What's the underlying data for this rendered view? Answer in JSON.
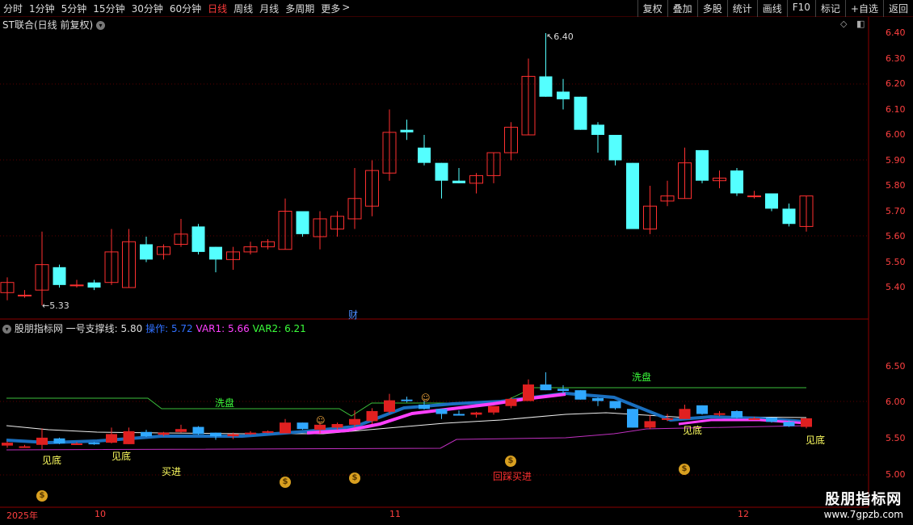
{
  "toolbar": {
    "periods": [
      "分时",
      "1分钟",
      "5分钟",
      "15分钟",
      "30分钟",
      "60分钟",
      "日线",
      "周线",
      "月线",
      "多周期",
      "更多"
    ],
    "active_period": "日线",
    "actions": [
      "复权",
      "叠加",
      "多股",
      "统计",
      "画线",
      "F10",
      "标记",
      "+自选",
      "返回"
    ]
  },
  "main_panel": {
    "title": "ST联合(日线 前复权)",
    "y_labels": [
      "6.40",
      "6.30",
      "6.20",
      "6.10",
      "6.00",
      "5.90",
      "5.80",
      "5.70",
      "5.60",
      "5.50",
      "5.40"
    ],
    "high_label": "6.40",
    "low_label": "5.33",
    "marker": "财"
  },
  "indicator_panel": {
    "name": "股朋指标网",
    "line1_label": "一号支撑线:",
    "line1_value": "5.80",
    "op_label": "操作:",
    "op_value": "5.72",
    "var1_label": "VAR1:",
    "var1_value": "5.66",
    "var2_label": "VAR2:",
    "var2_value": "6.21",
    "y_labels": [
      "6.50",
      "6.00",
      "5.50",
      "5.00"
    ],
    "annotations": {
      "wash1": "洗盘",
      "wash2": "洗盘",
      "bottom1": "见底",
      "bottom2": "见底",
      "bottom3": "见底",
      "bottom4": "见底",
      "buy": "买进",
      "pullback_buy": "回踩买进"
    }
  },
  "dates": [
    "2025年",
    "10",
    "11",
    "12"
  ],
  "watermark": {
    "title": "股朋指标网",
    "url": "www.7gpzb.com"
  },
  "colors": {
    "up": "#ff3030",
    "down": "#54ffff",
    "axis": "#8b0000",
    "label": "#ff4040"
  },
  "chart_data": {
    "type": "candlestick",
    "title": "ST联合(日线 前复权)",
    "ylim": [
      5.33,
      6.4
    ],
    "candles": [
      {
        "o": 5.38,
        "c": 5.42,
        "h": 5.44,
        "l": 5.35
      },
      {
        "o": 5.37,
        "c": 5.37,
        "h": 5.39,
        "l": 5.36
      },
      {
        "o": 5.39,
        "c": 5.49,
        "h": 5.62,
        "l": 5.33
      },
      {
        "o": 5.48,
        "c": 5.41,
        "h": 5.49,
        "l": 5.4
      },
      {
        "o": 5.41,
        "c": 5.41,
        "h": 5.43,
        "l": 5.4
      },
      {
        "o": 5.42,
        "c": 5.4,
        "h": 5.43,
        "l": 5.39
      },
      {
        "o": 5.42,
        "c": 5.54,
        "h": 5.63,
        "l": 5.41
      },
      {
        "o": 5.4,
        "c": 5.58,
        "h": 5.63,
        "l": 5.4
      },
      {
        "o": 5.57,
        "c": 5.51,
        "h": 5.6,
        "l": 5.5
      },
      {
        "o": 5.53,
        "c": 5.56,
        "h": 5.57,
        "l": 5.51
      },
      {
        "o": 5.57,
        "c": 5.61,
        "h": 5.67,
        "l": 5.56
      },
      {
        "o": 5.64,
        "c": 5.54,
        "h": 5.65,
        "l": 5.53
      },
      {
        "o": 5.56,
        "c": 5.51,
        "h": 5.56,
        "l": 5.46
      },
      {
        "o": 5.51,
        "c": 5.54,
        "h": 5.56,
        "l": 5.47
      },
      {
        "o": 5.54,
        "c": 5.56,
        "h": 5.58,
        "l": 5.53
      },
      {
        "o": 5.56,
        "c": 5.58,
        "h": 5.59,
        "l": 5.55
      },
      {
        "o": 5.55,
        "c": 5.7,
        "h": 5.75,
        "l": 5.55
      },
      {
        "o": 5.7,
        "c": 5.61,
        "h": 5.7,
        "l": 5.6
      },
      {
        "o": 5.6,
        "c": 5.67,
        "h": 5.7,
        "l": 5.55
      },
      {
        "o": 5.63,
        "c": 5.68,
        "h": 5.7,
        "l": 5.6
      },
      {
        "o": 5.67,
        "c": 5.75,
        "h": 5.87,
        "l": 5.63
      },
      {
        "o": 5.72,
        "c": 5.86,
        "h": 5.9,
        "l": 5.68
      },
      {
        "o": 5.85,
        "c": 6.01,
        "h": 6.1,
        "l": 5.82
      },
      {
        "o": 6.02,
        "c": 6.01,
        "h": 6.06,
        "l": 5.98
      },
      {
        "o": 5.95,
        "c": 5.89,
        "h": 6.0,
        "l": 5.88
      },
      {
        "o": 5.89,
        "c": 5.82,
        "h": 5.89,
        "l": 5.75
      },
      {
        "o": 5.82,
        "c": 5.81,
        "h": 5.87,
        "l": 5.81
      },
      {
        "o": 5.81,
        "c": 5.84,
        "h": 5.85,
        "l": 5.77
      },
      {
        "o": 5.84,
        "c": 5.93,
        "h": 5.93,
        "l": 5.81
      },
      {
        "o": 5.93,
        "c": 6.03,
        "h": 6.05,
        "l": 5.9
      },
      {
        "o": 6.0,
        "c": 6.23,
        "h": 6.3,
        "l": 6.0
      },
      {
        "o": 6.23,
        "c": 6.15,
        "h": 6.4,
        "l": 6.15
      },
      {
        "o": 6.17,
        "c": 6.14,
        "h": 6.22,
        "l": 6.1
      },
      {
        "o": 6.15,
        "c": 6.02,
        "h": 6.15,
        "l": 6.02
      },
      {
        "o": 6.04,
        "c": 6.0,
        "h": 6.05,
        "l": 5.93
      },
      {
        "o": 6.0,
        "c": 5.9,
        "h": 6.0,
        "l": 5.88
      },
      {
        "o": 5.89,
        "c": 5.63,
        "h": 5.89,
        "l": 5.63
      },
      {
        "o": 5.63,
        "c": 5.72,
        "h": 5.8,
        "l": 5.61
      },
      {
        "o": 5.74,
        "c": 5.76,
        "h": 5.82,
        "l": 5.72
      },
      {
        "o": 5.75,
        "c": 5.89,
        "h": 5.95,
        "l": 5.75
      },
      {
        "o": 5.94,
        "c": 5.82,
        "h": 5.94,
        "l": 5.81
      },
      {
        "o": 5.82,
        "c": 5.83,
        "h": 5.86,
        "l": 5.79
      },
      {
        "o": 5.86,
        "c": 5.77,
        "h": 5.87,
        "l": 5.76
      },
      {
        "o": 5.76,
        "c": 5.76,
        "h": 5.78,
        "l": 5.75
      },
      {
        "o": 5.77,
        "c": 5.71,
        "h": 5.77,
        "l": 5.7
      },
      {
        "o": 5.71,
        "c": 5.65,
        "h": 5.73,
        "l": 5.64
      },
      {
        "o": 5.64,
        "c": 5.76,
        "h": 5.76,
        "l": 5.62
      }
    ]
  }
}
